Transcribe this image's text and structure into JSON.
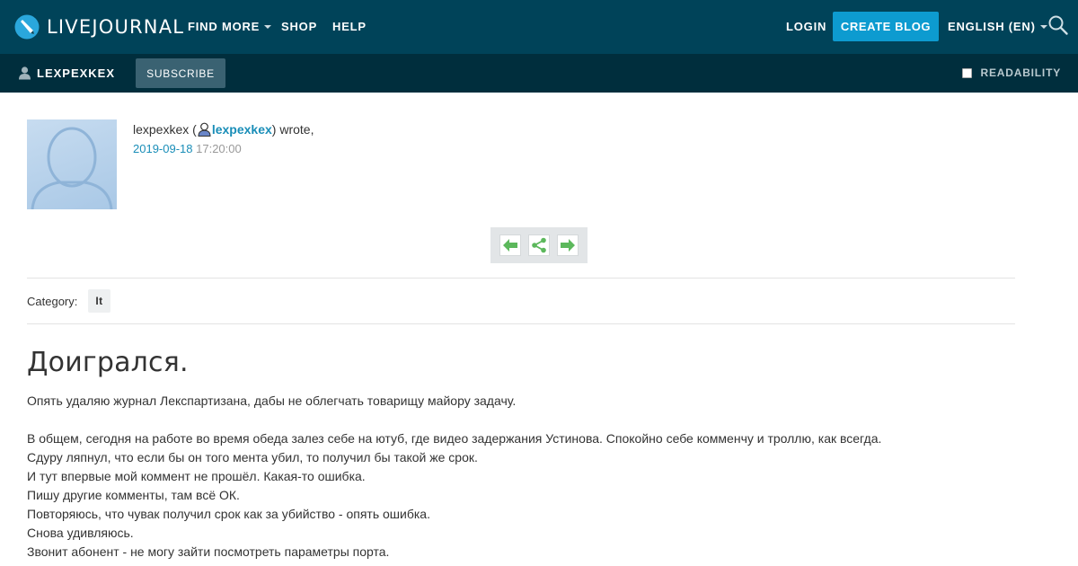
{
  "header": {
    "logo_text": "LIVEJOURNAL",
    "nav": [
      {
        "label": "FIND MORE",
        "has_dropdown": true
      },
      {
        "label": "SHOP",
        "has_dropdown": false
      },
      {
        "label": "HELP",
        "has_dropdown": false
      }
    ],
    "login_label": "LOGIN",
    "create_blog_label": "CREATE BLOG",
    "language_label": "ENGLISH (EN)",
    "search_icon": "search-icon",
    "colors": {
      "bar": "#004359",
      "accent": "#0d9bd0"
    }
  },
  "subbar": {
    "username": "LEXPEXKEX",
    "subscribe_label": "SUBSCRIBE",
    "readability_label": "READABILITY",
    "readability_checked": false,
    "colors": {
      "bar": "#002e3d"
    }
  },
  "entry": {
    "poster_name": "lexpexkex",
    "poster_link": "lexpexkex",
    "wrote_text": "wrote,",
    "date": "2019-09-18",
    "time": "17:20:00",
    "category_label": "Category:",
    "category_tag": "It",
    "title": "Доигрался.",
    "body": [
      "Опять удаляю журнал Лекспартизана, дабы не облегчать товарищу майору задачу.",
      "",
      "В общем, сегодня на работе во время обеда залез себе на ютуб, где видео задержания Устинова. Спокойно себе комменчу и троллю, как всегда.",
      "Сдуру ляпнул, что если бы он того мента убил, то получил бы такой же срок.",
      "И тут впервые мой коммент не прошёл. Какая-то ошибка.",
      "Пишу другие комменты, там всё ОК.",
      "Повторяюсь, что чувак получил срок как за убийство - опять ошибка.",
      "Снова удивляюсь.",
      "Звонит абонент - не могу зайти посмотреть параметры порта."
    ]
  }
}
